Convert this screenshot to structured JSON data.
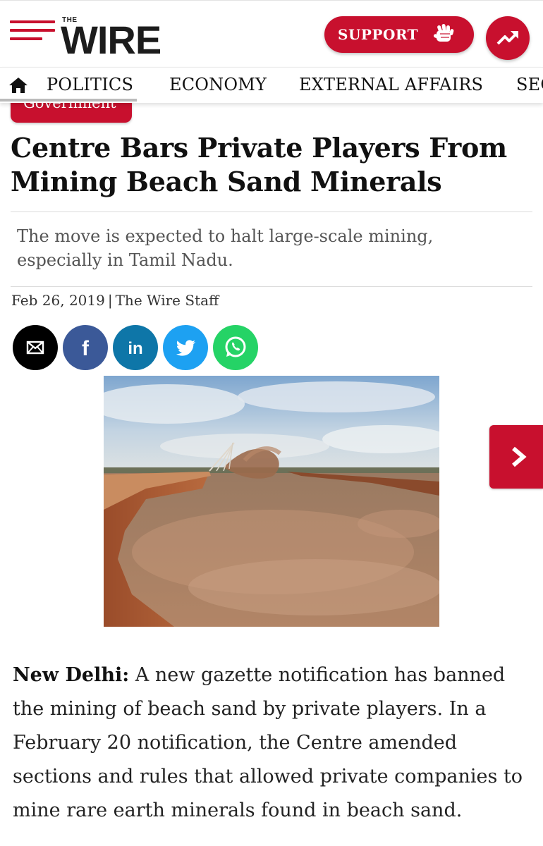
{
  "header": {
    "logo_small": "THE",
    "logo_main": "WIRE",
    "support_label": "SUPPORT",
    "menu_icon": "hamburger-menu-icon",
    "support_icon": "fist-hand-icon",
    "trending_icon": "trending-up-icon"
  },
  "nav": {
    "home_icon": "home-icon",
    "items": [
      "POLITICS",
      "ECONOMY",
      "EXTERNAL AFFAIRS",
      "SECURITY"
    ]
  },
  "article": {
    "category": "Government",
    "headline_line1": "Centre Bars Private Players From",
    "headline_line2": "Mining Beach Sand Minerals",
    "dek_line1": "The move is expected to halt large-scale mining,",
    "dek_line2": "especially in Tamil Nadu.",
    "date": "Feb 26, 2019",
    "separator": "|",
    "author": "The Wire Staff",
    "body_lead": "New Delhi:",
    "body_text": " A new gazette notification has banned the mining of beach sand by private players. In a February 20 notification, the Centre amended sections and rules that allowed private companies to mine rare earth minerals found in beach sand."
  },
  "share": [
    {
      "name": "email",
      "icon": "email-icon",
      "color": "#000000"
    },
    {
      "name": "facebook",
      "icon": "facebook-icon",
      "color": "#3b5998"
    },
    {
      "name": "linkedin",
      "icon": "linkedin-icon",
      "color": "#0e76a8"
    },
    {
      "name": "twitter",
      "icon": "twitter-icon",
      "color": "#1da1f2"
    },
    {
      "name": "whatsapp",
      "icon": "whatsapp-icon",
      "color": "#25d366"
    }
  ],
  "image": {
    "subject": "beach sand mining photo"
  },
  "colors": {
    "brand_red": "#c8102e",
    "text": "#1a1a1a",
    "dek": "#555555"
  },
  "next_icon": "chevron-right-icon"
}
